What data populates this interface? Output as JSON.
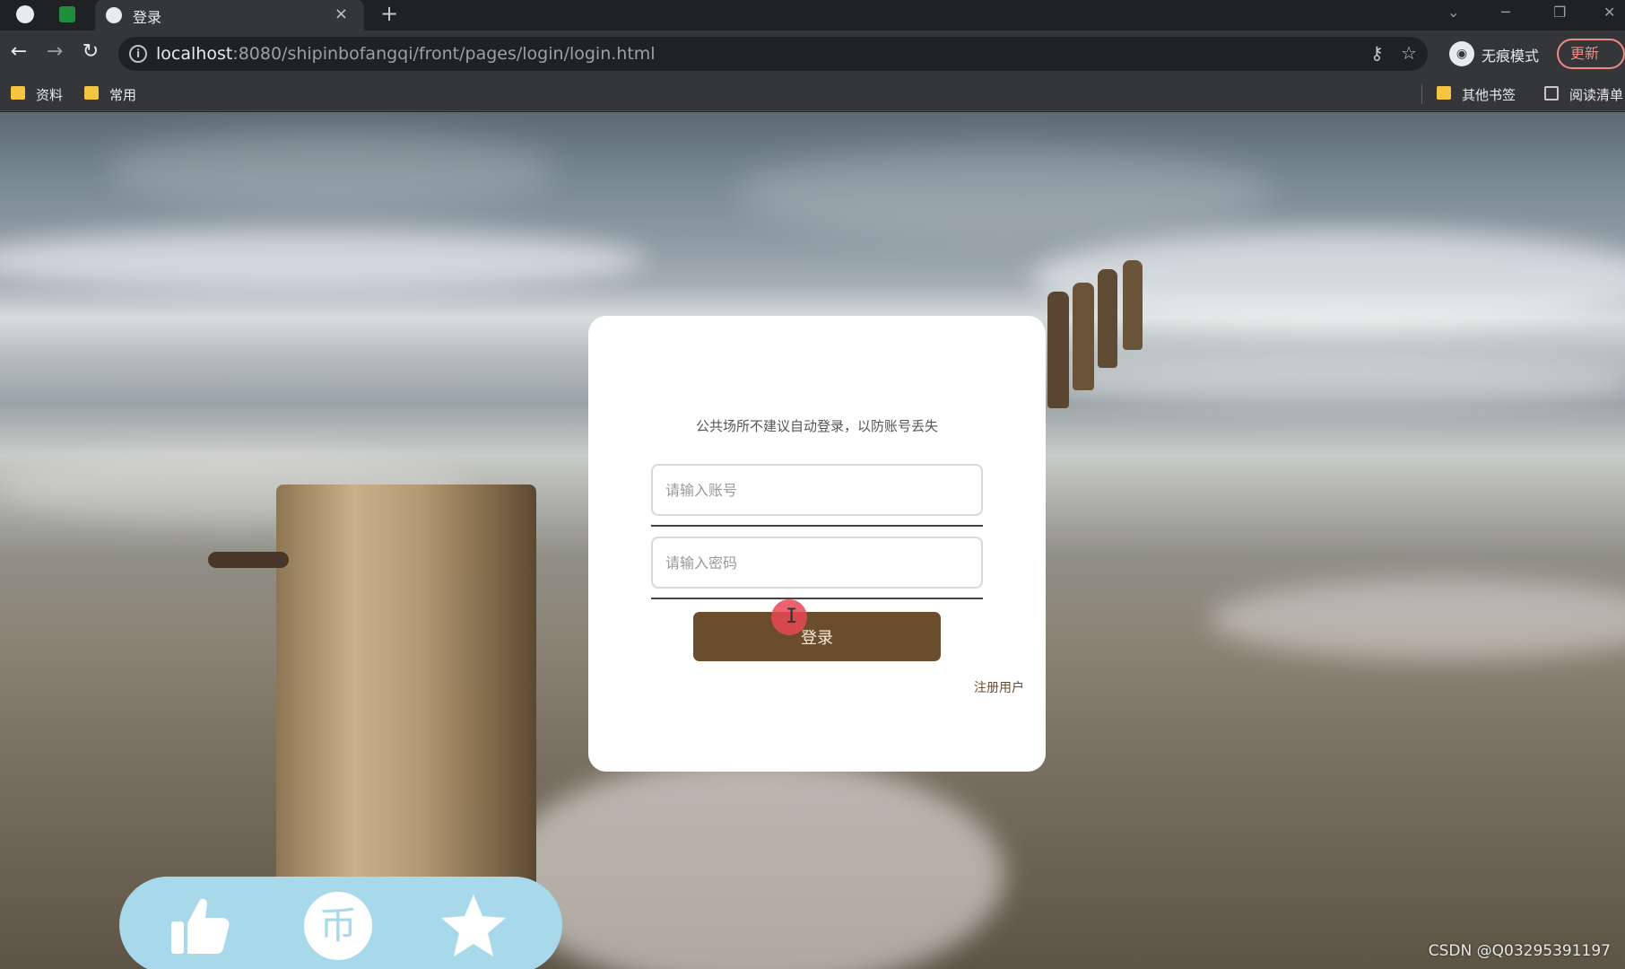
{
  "browser": {
    "tab": {
      "title": "登录",
      "close_label": "×"
    },
    "new_tab_label": "+",
    "window_controls": {
      "minimize": "─",
      "restore": "❐",
      "close": "✕",
      "tab_search": "⌄"
    },
    "url": {
      "host": "localhost",
      "path": ":8080/shipinbofangqi/front/pages/login/login.html"
    },
    "incognito_label": "无痕模式",
    "update_label": "更新",
    "bookmarks": {
      "left": [
        "资料",
        "常用"
      ],
      "other": "其他书签",
      "reading_list": "阅读清单"
    }
  },
  "login": {
    "tip": "公共场所不建议自动登录，以防账号丢失",
    "account_placeholder": "请输入账号",
    "password_placeholder": "请输入密码",
    "login_button": "登录",
    "register_link": "注册用户"
  },
  "action_panel": {
    "icons": [
      "thumbs-up-icon",
      "coin-icon",
      "star-icon"
    ],
    "coin_glyph": "币",
    "color": "#a8d9ea"
  },
  "watermark": "CSDN @Q03295391197",
  "colors": {
    "accent": "#6b4c2c",
    "chrome_dark": "#202124",
    "chrome": "#35363a"
  }
}
